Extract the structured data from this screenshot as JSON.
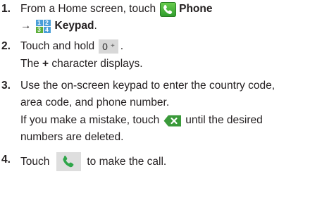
{
  "steps": [
    {
      "number": "1.",
      "line1_text": "From a Home screen, touch",
      "phone_label": "Phone",
      "arrow": "→",
      "keypad_label": "Keypad",
      "end_punct": "."
    },
    {
      "number": "2.",
      "line1_text": "Touch and hold",
      "key_zero": "0",
      "key_plus": "+",
      "end_punct": ".",
      "line2_plus": "+",
      "line2_text": " character displays.",
      "line2_prefix": "The "
    },
    {
      "number": "3.",
      "line1": "Use the on-screen keypad to enter the country code,",
      "line2": "area code, and phone number.",
      "line3_before": "If you make a mistake, touch",
      "line3_after": "until the desired",
      "line4": "numbers are deleted."
    },
    {
      "number": "4.",
      "before": "Touch",
      "after": "to make the call."
    }
  ],
  "keypad_icon_digits": [
    "1",
    "2",
    "3",
    "4"
  ],
  "icons": {
    "phone_app": "phone-app-icon",
    "keypad": "keypad-icon",
    "delete": "delete-key-icon",
    "call": "call-button-icon"
  },
  "colors": {
    "text": "#231f20",
    "phone_green": "#2e9a2c",
    "keypad_blue": "#4a9fd8",
    "key_gray": "#d8d8d8",
    "delete_green": "#3a9a3a"
  }
}
